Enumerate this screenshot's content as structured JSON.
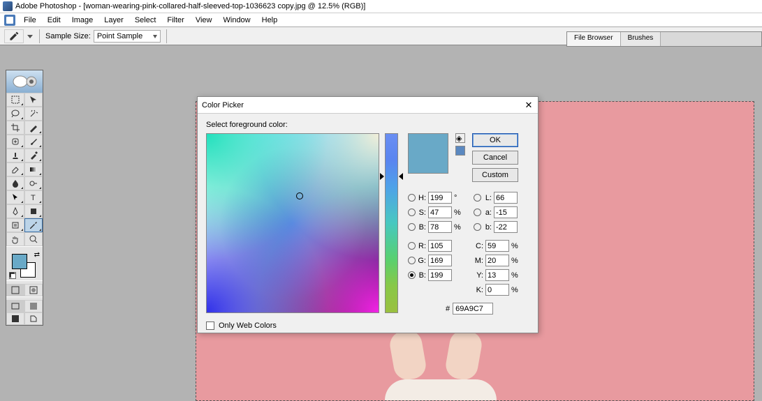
{
  "window": {
    "title": "Adobe Photoshop - [woman-wearing-pink-collared-half-sleeved-top-1036623 copy.jpg @ 12.5% (RGB)]"
  },
  "menubar": [
    "File",
    "Edit",
    "Image",
    "Layer",
    "Select",
    "Filter",
    "View",
    "Window",
    "Help"
  ],
  "options_bar": {
    "sample_size_label": "Sample Size:",
    "sample_size_value": "Point Sample"
  },
  "palette_tabs": [
    "File Browser",
    "Brushes"
  ],
  "toolbox": {
    "foreground_color": "#69a9c7",
    "background_color": "#ffffff"
  },
  "color_picker": {
    "title": "Color Picker",
    "prompt": "Select foreground color:",
    "buttons": {
      "ok": "OK",
      "cancel": "Cancel",
      "custom": "Custom"
    },
    "hsb": {
      "h": "199",
      "h_unit": "°",
      "s": "47",
      "s_unit": "%",
      "b": "78",
      "b_unit": "%"
    },
    "lab": {
      "l": "66",
      "a": "-15",
      "b": "-22"
    },
    "rgb": {
      "r": "105",
      "g": "169",
      "b": "199"
    },
    "cmyk": {
      "c": "59",
      "m": "20",
      "y": "13",
      "k": "0",
      "unit": "%"
    },
    "hex_label": "#",
    "hex": "69A9C7",
    "web_only_label": "Only Web Colors",
    "selected_radio": "rgb_b",
    "labels": {
      "H": "H:",
      "S": "S:",
      "Bv": "B:",
      "L": "L:",
      "a": "a:",
      "lb": "b:",
      "R": "R:",
      "G": "G:",
      "Bc": "B:",
      "C": "C:",
      "M": "M:",
      "Y": "Y:",
      "K": "K:"
    }
  }
}
